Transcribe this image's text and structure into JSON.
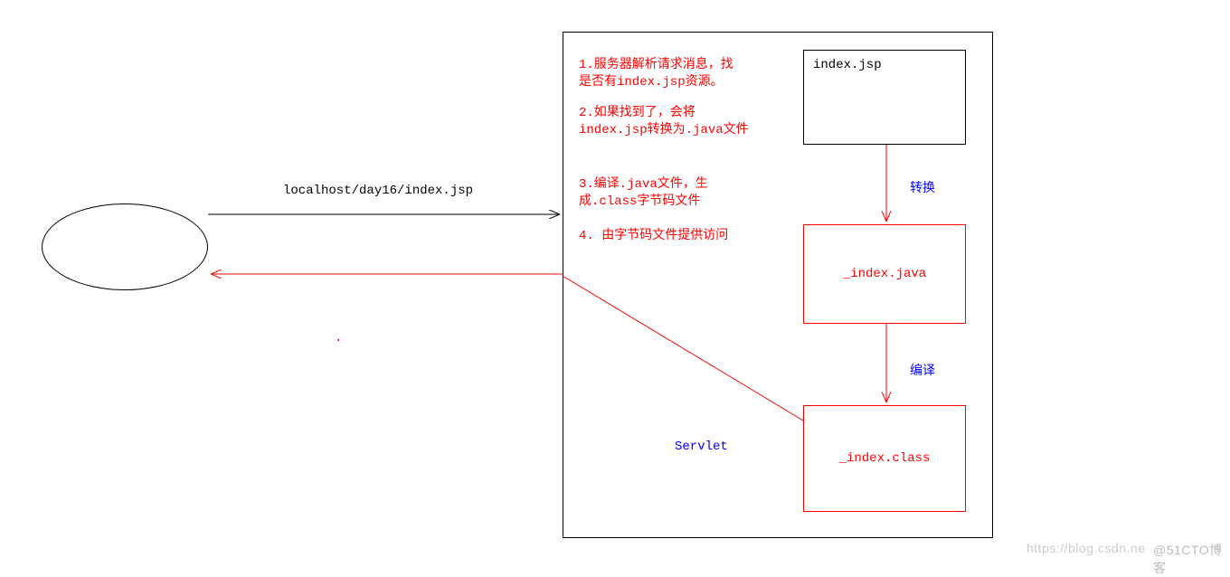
{
  "request_label": "localhost/day16/index.jsp",
  "steps": {
    "s1": "1.服务器解析请求消息，找\n是否有index.jsp资源。",
    "s2": "2.如果找到了，会将\nindex.jsp转换为.java文件",
    "s3": "3.编译.java文件，生\n成.class字节码文件",
    "s4": "4. 由字节码文件提供访问"
  },
  "boxes": {
    "jsp": "index.jsp",
    "java": "_index.java",
    "clazz": "_index.class"
  },
  "arrows": {
    "convert": "转换",
    "compile": "编译"
  },
  "servlet": "Servlet",
  "watermark_left": "https://blog.csdn.ne",
  "watermark_right": "@51CTO博客"
}
